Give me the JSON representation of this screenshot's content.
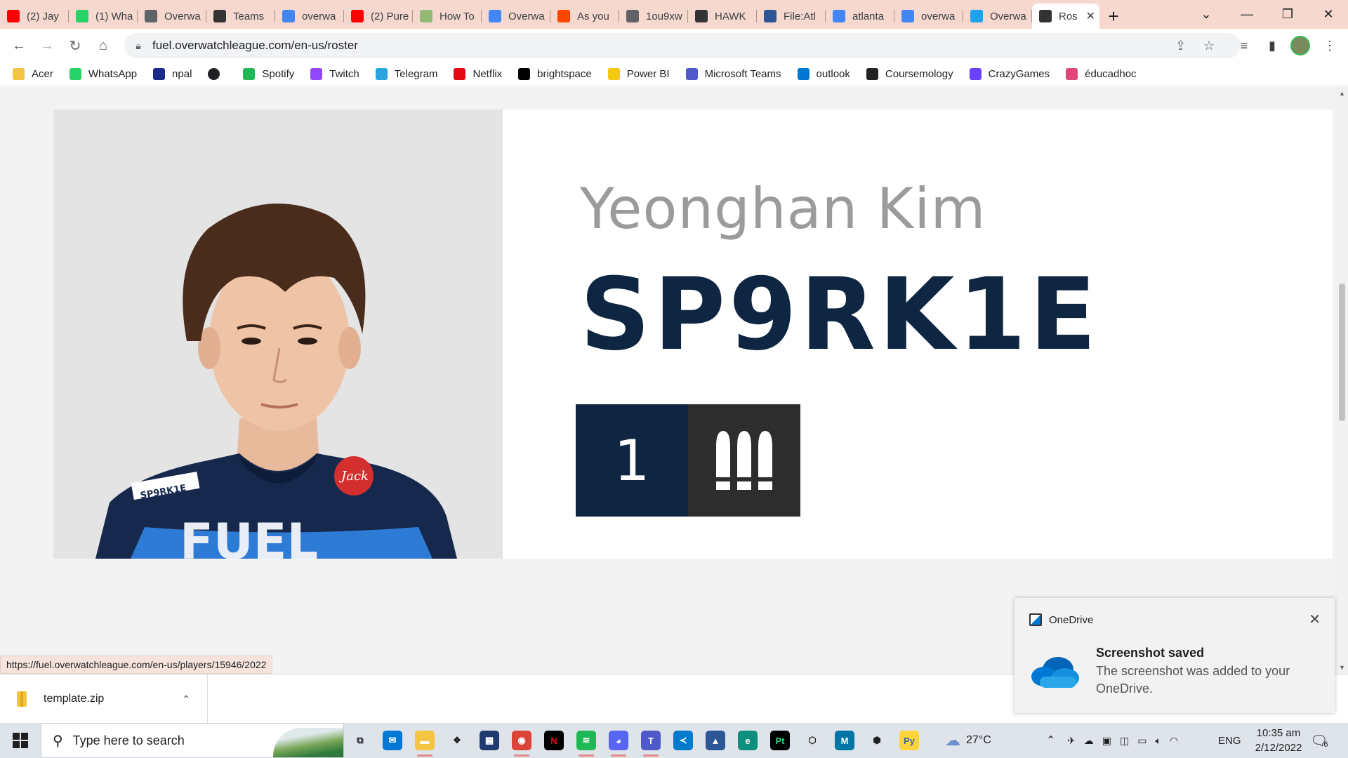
{
  "tabs": [
    {
      "title": "(2) Jay",
      "icon": "youtube-icon",
      "color": "#ff0000"
    },
    {
      "title": "(1) Wha",
      "icon": "whatsapp-icon",
      "color": "#25d366"
    },
    {
      "title": "Overwa",
      "icon": "overwatch-icon",
      "color": "#5f6368"
    },
    {
      "title": "Teams",
      "icon": "owl-team-icon",
      "color": "#333333"
    },
    {
      "title": "overwa",
      "icon": "google-icon",
      "color": "#4285f4"
    },
    {
      "title": "(2) Pure",
      "icon": "youtube-icon",
      "color": "#ff0000"
    },
    {
      "title": "How To",
      "icon": "wikihow-icon",
      "color": "#93b874"
    },
    {
      "title": "Overwa",
      "icon": "google-icon",
      "color": "#4285f4"
    },
    {
      "title": "As you",
      "icon": "reddit-icon",
      "color": "#ff4500"
    },
    {
      "title": "1ou9xw",
      "icon": "globe-icon",
      "color": "#5f6368"
    },
    {
      "title": "HAWK",
      "icon": "owl-team-icon",
      "color": "#333333"
    },
    {
      "title": "File:Atl",
      "icon": "wiki-icon",
      "color": "#2b5797"
    },
    {
      "title": "atlanta",
      "icon": "google-icon",
      "color": "#4285f4"
    },
    {
      "title": "overwa",
      "icon": "google-icon",
      "color": "#4285f4"
    },
    {
      "title": "Overwa",
      "icon": "twitter-icon",
      "color": "#1da1f2"
    },
    {
      "title": "Ros",
      "icon": "owl-team-icon",
      "color": "#333333",
      "active": true
    }
  ],
  "address": {
    "url": "fuel.overwatchleague.com/en-us/roster"
  },
  "bookmarks": [
    {
      "label": "Acer",
      "icon": "folder-icon",
      "color": "#f4c542"
    },
    {
      "label": "WhatsApp",
      "icon": "whatsapp-icon",
      "color": "#25d366"
    },
    {
      "label": "npal",
      "icon": "npal-icon",
      "color": "#1a2a8a"
    },
    {
      "label": "",
      "icon": "globe-icon",
      "color": "#202124"
    },
    {
      "label": "Spotify",
      "icon": "spotify-icon",
      "color": "#1db954"
    },
    {
      "label": "Twitch",
      "icon": "twitch-icon",
      "color": "#9146ff"
    },
    {
      "label": "Telegram",
      "icon": "telegram-icon",
      "color": "#2aa3df"
    },
    {
      "label": "Netflix",
      "icon": "netflix-icon",
      "color": "#e50914"
    },
    {
      "label": "brightspace",
      "icon": "np-icon",
      "color": "#000000"
    },
    {
      "label": "Power BI",
      "icon": "powerbi-icon",
      "color": "#f2c811"
    },
    {
      "label": "Microsoft Teams",
      "icon": "teams-icon",
      "color": "#5059c9"
    },
    {
      "label": "outlook",
      "icon": "outlook-icon",
      "color": "#0078d4"
    },
    {
      "label": "Coursemology",
      "icon": "coursemology-icon",
      "color": "#222222"
    },
    {
      "label": "CrazyGames",
      "icon": "crazygames-icon",
      "color": "#6842ff"
    },
    {
      "label": "éducadhoc",
      "icon": "educadhoc-icon",
      "color": "#e0457b"
    }
  ],
  "player": {
    "real_name": "Yeonghan Kim",
    "handle": "SP9RK1E",
    "number": "1",
    "role_icon": "damage-role-icon",
    "jersey_name": "SP9RK1E",
    "jersey_team": "FUEL"
  },
  "status_url": "https://fuel.overwatchleague.com/en-us/players/15946/2022",
  "download": {
    "filename": "template.zip"
  },
  "toast": {
    "app": "OneDrive",
    "title": "Screenshot saved",
    "body": "The screenshot was added to your OneDrive."
  },
  "taskbar": {
    "search_placeholder": "Type here to search",
    "weather": "27°C",
    "language": "ENG",
    "time": "10:35 am",
    "date": "2/12/2022",
    "notifications": "6"
  },
  "colors": {
    "navy": "#0e2642",
    "role_bg": "#2d2d2d",
    "tab_strip": "#f6d8cf",
    "realname_gray": "#9b9b9b"
  }
}
